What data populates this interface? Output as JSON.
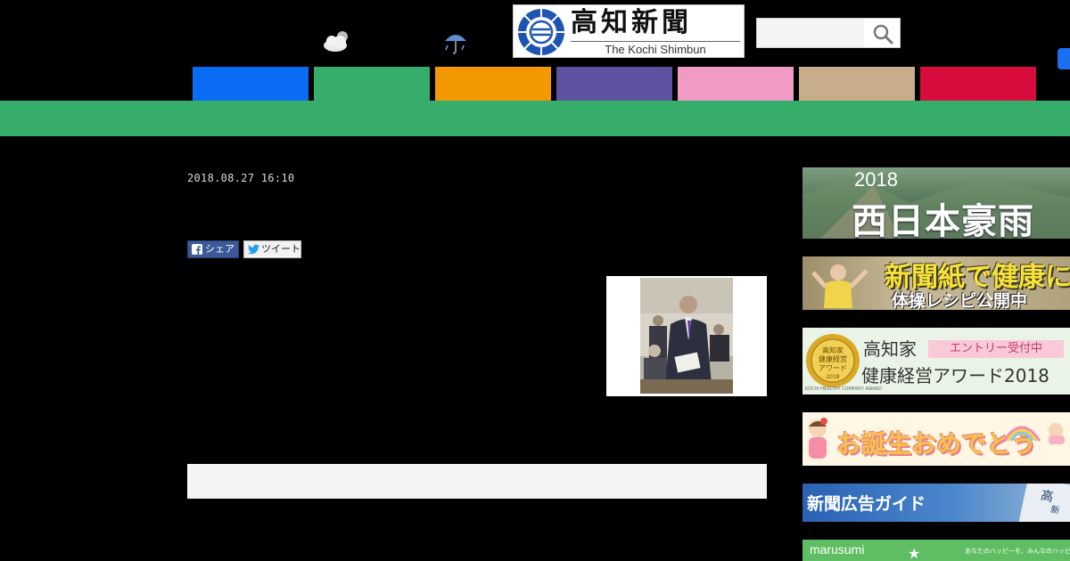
{
  "header": {
    "weather_icons": [
      "cloud-sun-icon",
      "rain-umbrella-icon"
    ],
    "logo": {
      "kanji": "高知新聞",
      "english": "The Kochi Shimbun"
    },
    "search": {
      "placeholder": "",
      "value": ""
    }
  },
  "nav": {
    "tabs": [
      {
        "label": "",
        "color": "#0a6cf5"
      },
      {
        "label": "",
        "color": "#36ad6a"
      },
      {
        "label": "",
        "color": "#f39800"
      },
      {
        "label": "",
        "color": "#5c52a1"
      },
      {
        "label": "",
        "color": "#f09ac4"
      },
      {
        "label": "",
        "color": "#c8ad8a"
      },
      {
        "label": "",
        "color": "#d70c3d"
      }
    ],
    "active_band_color": "#36ad6a"
  },
  "article": {
    "date": "2018.08.27 16:10",
    "share": {
      "facebook": "シェア",
      "twitter": "ツイート"
    }
  },
  "sidebar": {
    "banners": {
      "flood": {
        "year": "2018",
        "title": "西日本豪雨"
      },
      "health": {
        "line1": "新聞紙で健康に",
        "line2": "体操レシピ公開中"
      },
      "award": {
        "line1": "高知家",
        "entry": "エントリー受付中",
        "line2": "健康経営アワード2018",
        "medal_text": "高知家 健康経営 アワード 2018",
        "small": "KOCHI HEALTHY COMPANY AWARD"
      },
      "birth": {
        "text": "お誕生おめでとう"
      },
      "adguide": {
        "text": "新聞広告ガイド"
      },
      "marusumi": {
        "name": "marusumi",
        "tagline": "あなたのハッピーを、みんなのハッピーに。"
      }
    }
  }
}
